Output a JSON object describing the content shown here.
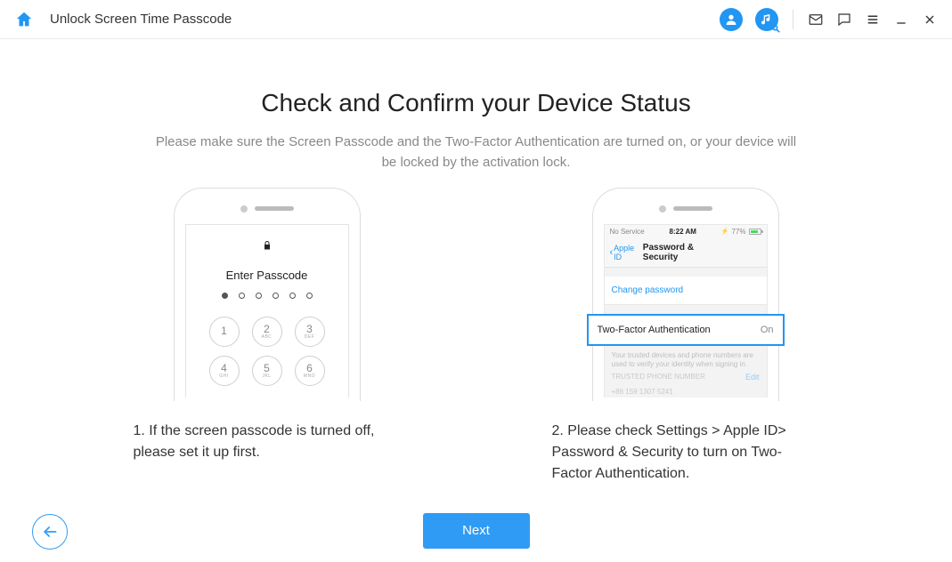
{
  "header": {
    "title": "Unlock Screen Time Passcode"
  },
  "main": {
    "title": "Check and Confirm your Device Status",
    "subtitle": "Please make sure the Screen Passcode and the Two-Factor Authentication are turned on, or your device will be locked by the activation lock."
  },
  "left_phone": {
    "enter_passcode": "Enter Passcode",
    "keys": [
      {
        "num": "1",
        "let": ""
      },
      {
        "num": "2",
        "let": "ABC"
      },
      {
        "num": "3",
        "let": "DEF"
      },
      {
        "num": "4",
        "let": "GHI"
      },
      {
        "num": "5",
        "let": "JKL"
      },
      {
        "num": "6",
        "let": "MNO"
      }
    ]
  },
  "right_phone": {
    "status": {
      "carrier": "No Service",
      "time": "8:22 AM",
      "battery": "77%"
    },
    "nav_back": "Apple ID",
    "nav_title": "Password & Security",
    "change_password": "Change password",
    "twofa_label": "Two-Factor Authentication",
    "twofa_value": "On",
    "trusted_text": "Your trusted devices and phone numbers are used to verify your identity when signing in.",
    "edit": "Edit",
    "phone_label": "TRUSTED PHONE NUMBER",
    "phone_number": "+86 159 1307 5241"
  },
  "captions": {
    "left": "1. If the screen passcode is turned off, please set it up first.",
    "right": "2. Please check Settings > Apple ID> Password & Security to turn on Two-Factor Authentication."
  },
  "buttons": {
    "next": "Next"
  }
}
